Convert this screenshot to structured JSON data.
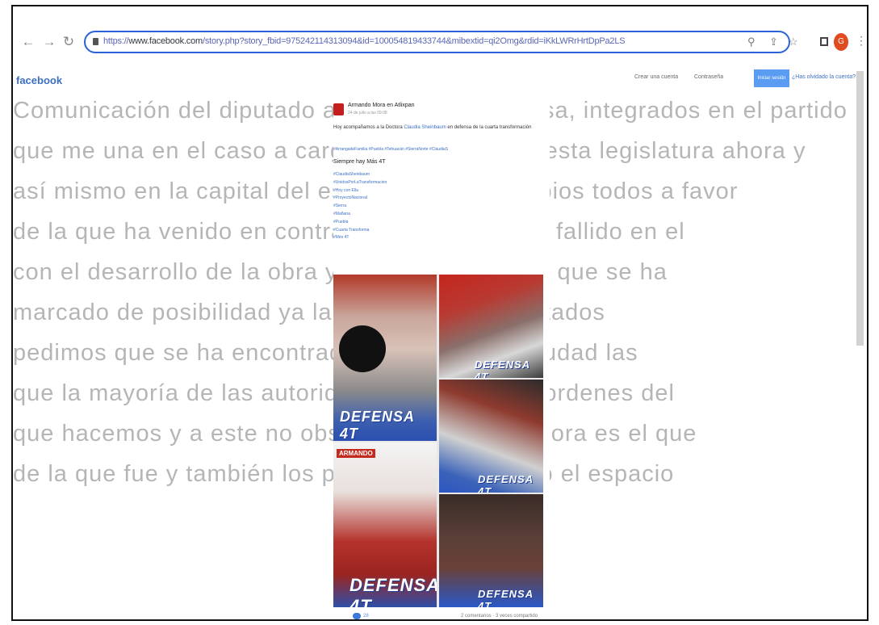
{
  "browser": {
    "url_prefix": "https://",
    "url_domain": "www.facebook.com",
    "url_path": "/story.php?story_fbid=975242114313094&id=100054819433744&mibextid=qi2Omg&rdid=iKkLWRrHrtDpPa2LS",
    "back_icon": "arrow-left-icon",
    "forward_icon": "arrow-right-icon",
    "reload_icon": "reload-icon",
    "avatar_letter": "G"
  },
  "facebook": {
    "logo": "facebook",
    "links": [
      "Crear una cuenta",
      "Contraseña"
    ],
    "login_button": "Iniciar sesión",
    "signup_link": "¿Has olvidado la cuenta?"
  },
  "post": {
    "author": "Armando Mora",
    "author_suffix": "en Atlixpan",
    "date": "24 de julio a las 09:08",
    "text_prefix": "Hoy acompañamos a la Doctora ",
    "text_link": "Claudia Sheinbaum",
    "text_suffix": " en defensa de la cuarta transformación",
    "hashtag_line": "#ArrangadeFamilia   #Puebla   #Tehuacán   #SierraNorte   #ClaudiaS",
    "label": "Siempre hay Más 4T",
    "hashtags": [
      "#ClaudiaSheinbaum",
      "#UnidosPorLaTransformacion",
      "#Hoy con Ella",
      "#ProyectoNacional",
      "#Sierra",
      "#Mañana",
      "#Puebla",
      "#Cuarta Transforma",
      "#Méx 4T"
    ],
    "banner": "DEFENSA 4T",
    "red_tag": "ARMANDO"
  },
  "background_lines": [
    "Comunicación del diputado ahora bajo la Defensa, integrados en el partido",
    "que me una en el caso a cargo del proyecto de esta legislatura ahora y",
    "así mismo en la capital del estado y sus municipios todos a favor",
    "de la que ha venido en contra el que se ha visto fallido en el",
    "con el desarrollo de la obra y con muchas por lo que se ha",
    "marcado de posibilidad ya la mitad de en los estados",
    "pedimos que se ha encontrado en favor de la ciudad las",
    "que la mayoría de las autoridades y de los tres ordenes del",
    "que hacemos y a este no obstante en la obra ahora es el que",
    "de la que fue y también los partidos que se llevó el espacio"
  ],
  "footer": {
    "reactions": "28",
    "comments": "2 comentarios · 3 veces compartido"
  }
}
